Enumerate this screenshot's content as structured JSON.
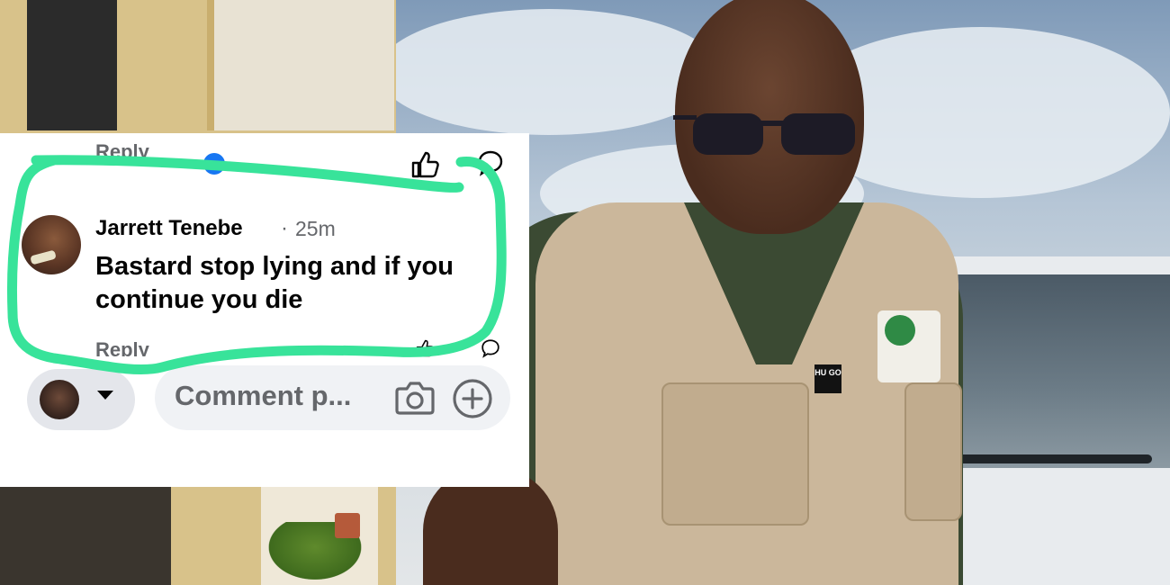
{
  "background": {
    "badge_text": "HU GO"
  },
  "comment_card": {
    "previous_reply_label": "Reply",
    "comment": {
      "author": "Jarrett Tenebe",
      "separator": "·",
      "time": "25m",
      "text": "Bastard stop lying and if you continue you die",
      "reply_label": "Reply"
    },
    "composer": {
      "placeholder": "Comment p...",
      "camera_icon": "camera-icon",
      "plus_icon": "plus-icon",
      "author_picker_icon": "chevron-down-icon"
    }
  },
  "colors": {
    "marker": "#38e39a",
    "text_primary": "#050505",
    "text_secondary": "#65676b",
    "pill_bg": "#f0f2f5"
  }
}
